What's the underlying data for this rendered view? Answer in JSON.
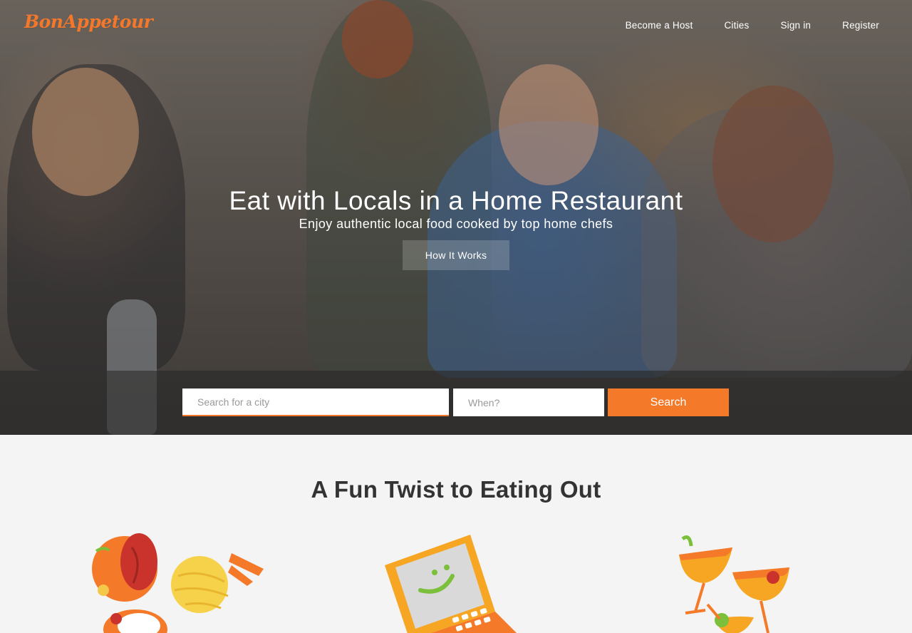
{
  "brand": {
    "logo_text": "BonAppetour",
    "accent": "#f4782c"
  },
  "nav": {
    "items": [
      {
        "label": "Become a Host"
      },
      {
        "label": "Cities"
      },
      {
        "label": "Sign in"
      },
      {
        "label": "Register"
      }
    ]
  },
  "hero": {
    "title": "Eat with Locals in a Home Restaurant",
    "subtitle": "Enjoy authentic local food cooked by top home chefs",
    "cta_label": "How It Works"
  },
  "search": {
    "city_placeholder": "Search for a city",
    "when_placeholder": "When?",
    "button_label": "Search"
  },
  "section": {
    "title": "A Fun Twist to Eating Out",
    "illustrations": [
      "food-illustration",
      "laptop-illustration",
      "cocktail-illustration"
    ]
  }
}
